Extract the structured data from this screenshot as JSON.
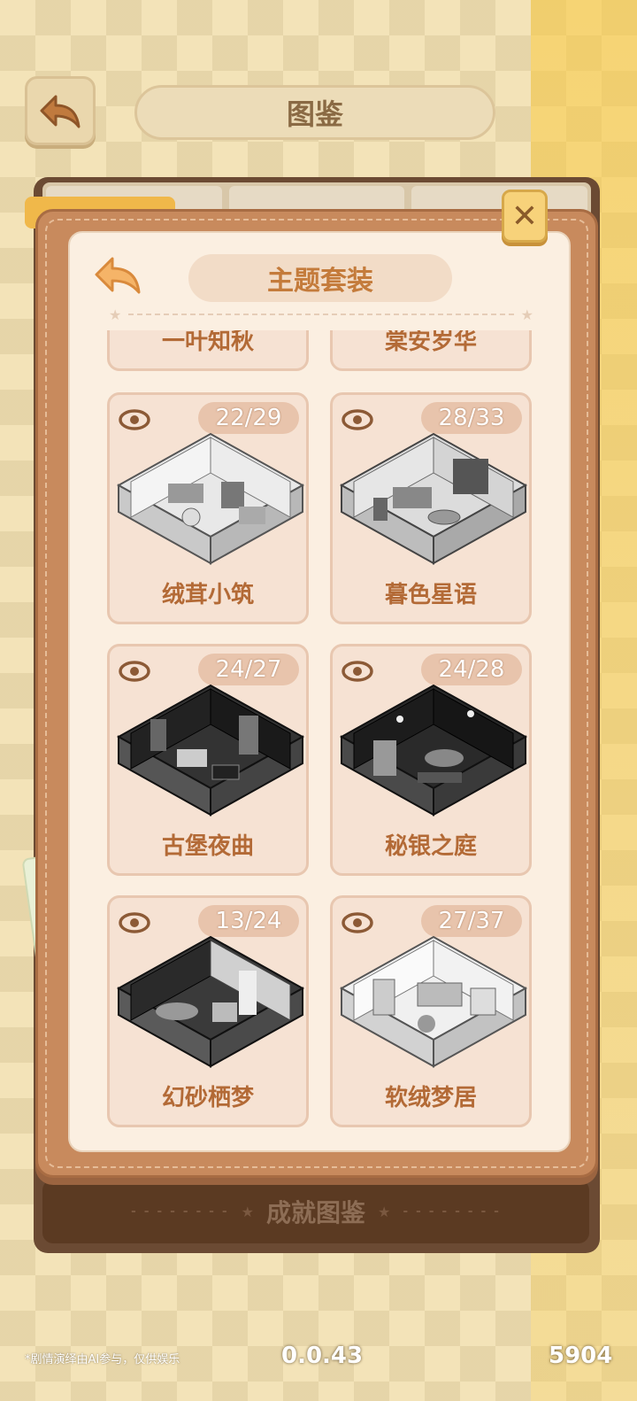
{
  "header": {
    "title": "图鉴"
  },
  "modal": {
    "title": "主题套装",
    "close_label": "✕"
  },
  "sets": [
    {
      "name": "一叶知秋",
      "count": "",
      "tone": "light"
    },
    {
      "name": "棠安岁华",
      "count": "",
      "tone": "light"
    },
    {
      "name": "绒茸小筑",
      "count": "22/29",
      "tone": "light"
    },
    {
      "name": "暮色星语",
      "count": "28/33",
      "tone": "light"
    },
    {
      "name": "古堡夜曲",
      "count": "24/27",
      "tone": "dark"
    },
    {
      "name": "秘银之庭",
      "count": "24/28",
      "tone": "dark"
    },
    {
      "name": "幻砂栖梦",
      "count": "13/24",
      "tone": "dark"
    },
    {
      "name": "软绒梦居",
      "count": "27/37",
      "tone": "light"
    }
  ],
  "achievement_bar": {
    "label": "成就图鉴"
  },
  "footer": {
    "note": "*剧情演绎由AI参与，仅供娱乐",
    "version": "0.0.43",
    "number": "5904"
  },
  "colors": {
    "accent": "#c47b3b",
    "card_bg": "#f6e2d3",
    "count_badge": "#e8c4ac",
    "modal_frame": "#c88a5d"
  }
}
